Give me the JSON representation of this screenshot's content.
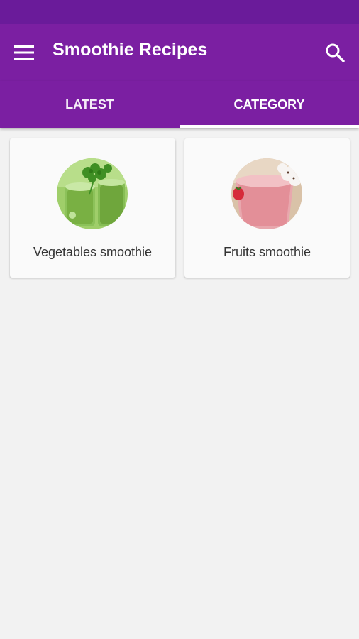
{
  "app": {
    "title": "Smoothie Recipes",
    "colors": {
      "status_bar": "#6a1b9a",
      "primary": "#7b1fa2",
      "background": "#f2f2f2",
      "card": "#fafafa",
      "text": "#333333"
    },
    "icons": {
      "menu": "menu-icon",
      "search": "search-icon"
    }
  },
  "tabs": [
    {
      "label": "LATEST",
      "selected": false
    },
    {
      "label": "CATEGORY",
      "selected": true
    }
  ],
  "categories": [
    {
      "label": "Vegetables smoothie",
      "image": "green vegetable smoothie glasses with parsley"
    },
    {
      "label": "Fruits smoothie",
      "image": "pink strawberry smoothie glass with whipped cream"
    }
  ]
}
